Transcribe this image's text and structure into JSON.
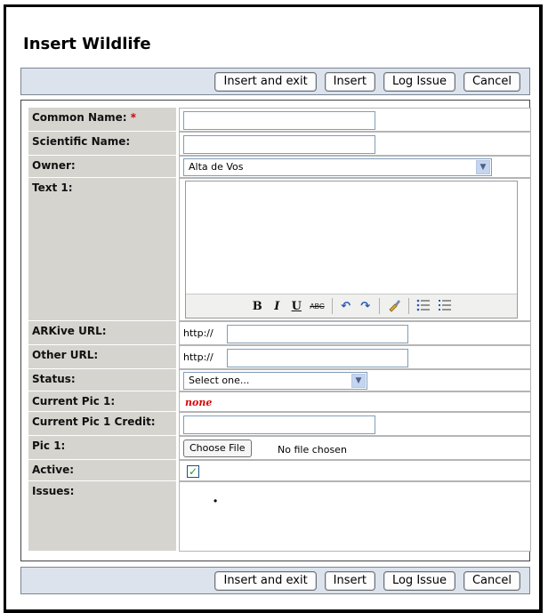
{
  "page": {
    "title": "Insert Wildlife"
  },
  "buttons": {
    "insert_and_exit": "Insert and exit",
    "insert": "Insert",
    "log_issue": "Log Issue",
    "cancel": "Cancel"
  },
  "form": {
    "common_name": {
      "label": "Common Name:",
      "required_mark": "*",
      "value": ""
    },
    "scientific_name": {
      "label": "Scientific Name:",
      "value": ""
    },
    "owner": {
      "label": "Owner:",
      "selected": "Alta de Vos"
    },
    "text1": {
      "label": "Text 1:",
      "value": "",
      "toolbar": {
        "bold": "B",
        "italic": "I",
        "underline": "U",
        "strikethrough": "ABC"
      }
    },
    "arkive_url": {
      "label": "ARKive URL:",
      "prefix": "http://",
      "value": ""
    },
    "other_url": {
      "label": "Other URL:",
      "prefix": "http://",
      "value": ""
    },
    "status": {
      "label": "Status:",
      "selected": "Select one..."
    },
    "current_pic1": {
      "label": "Current Pic 1:",
      "value": "none"
    },
    "current_pic1_credit": {
      "label": "Current Pic 1 Credit:",
      "value": ""
    },
    "pic1": {
      "label": "Pic 1:",
      "button": "Choose File",
      "status": "No file chosen"
    },
    "active": {
      "label": "Active:",
      "checked": true,
      "check_glyph": "✓"
    },
    "issues": {
      "label": "Issues:",
      "bullet": "•"
    }
  },
  "colors": {
    "label_bg": "#d6d4cf",
    "button_bar_bg": "#dde3ec",
    "required": "#d00000",
    "none_text": "#e00000"
  },
  "icons": [
    "chevron-down-icon",
    "undo-icon",
    "redo-icon",
    "cleanup-icon",
    "unordered-list-icon",
    "ordered-list-icon",
    "checkmark-icon"
  ]
}
